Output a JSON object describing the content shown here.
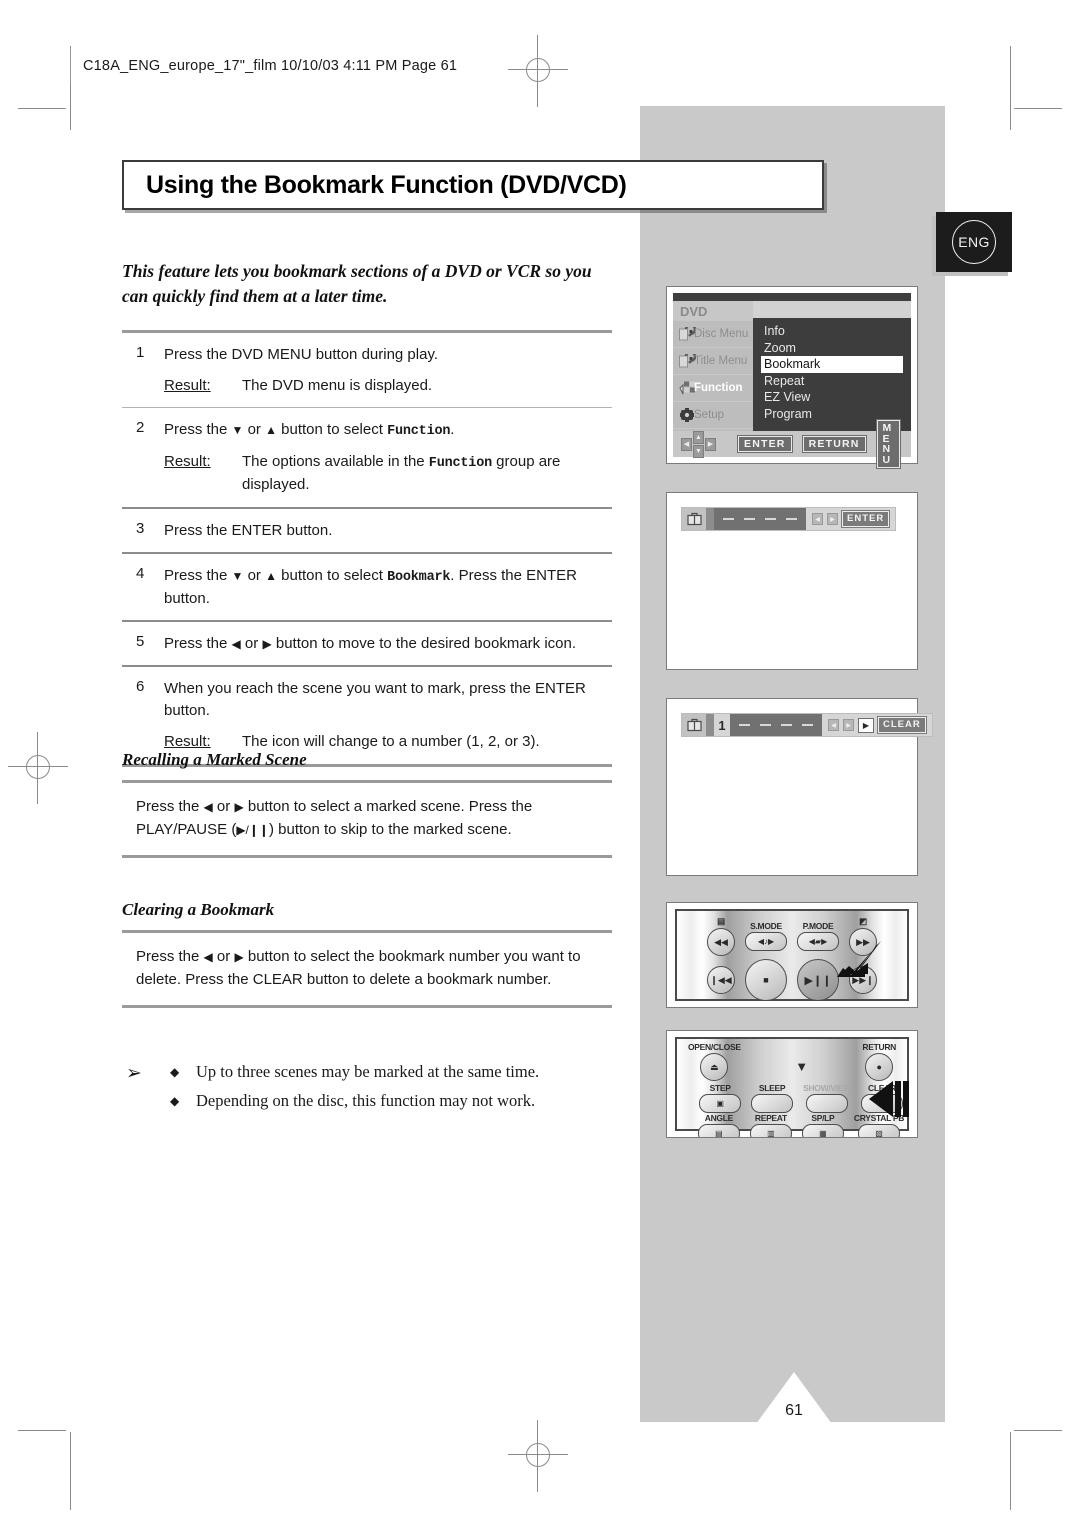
{
  "header": {
    "text": "C18A_ENG_europe_17\"_film  10/10/03  4:11 PM  Page 61"
  },
  "badge": {
    "label": "ENG"
  },
  "title": "Using the Bookmark Function (DVD/VCD)",
  "intro": "This feature lets you bookmark sections of a DVD or VCR so you can quickly find them at a later time.",
  "steps": [
    {
      "num": "1",
      "text_before": "Press the DVD MENU button during play.",
      "result_label": "Result:",
      "result_text": "The DVD menu is displayed."
    },
    {
      "num": "2",
      "text_a": "Press the ",
      "tri_down": "▼",
      "text_b": " or ",
      "tri_up": "▲",
      "text_c": " button to select ",
      "mono": "Function",
      "text_d": ".",
      "result_label": "Result:",
      "result_a": "The options available in the ",
      "result_mono": "Function",
      "result_b": " group are displayed."
    },
    {
      "num": "3",
      "text_before": "Press the ENTER button."
    },
    {
      "num": "4",
      "text_a": "Press the ",
      "tri_down": "▼",
      "text_b": " or ",
      "tri_up": "▲",
      "text_c": " button to select ",
      "mono": "Bookmark",
      "text_d": ". Press the ENTER button."
    },
    {
      "num": "5",
      "text_a": "Press the ",
      "tri_left": "◀",
      "text_b": " or ",
      "tri_right": "▶",
      "text_c": " button to move to the desired bookmark icon."
    },
    {
      "num": "6",
      "text_before": "When you reach the scene you want to mark, press the ENTER button.",
      "result_label": "Result:",
      "result_text": "The icon will change to a number (1, 2, or 3)."
    }
  ],
  "section_recall": {
    "heading": "Recalling a Marked Scene",
    "line_a": "Press the ",
    "tri_left": "◀",
    "line_b": " or ",
    "tri_right": "▶",
    "line_c": " button to select a marked scene. Press the PLAY/PAUSE (",
    "play_pause_glyph": "▶/❙❙",
    "line_d": ") button to skip to the marked scene."
  },
  "section_clear": {
    "heading": "Clearing a Bookmark",
    "line_a": "Press the ",
    "tri_left": "◀",
    "line_b": " or ",
    "tri_right": "▶",
    "line_c": " button to select the bookmark number you want to delete. Press the CLEAR button to delete a bookmark number."
  },
  "notes": {
    "arrow_glyph": "➢",
    "bullet_glyph": "◆",
    "items": [
      "Up to three scenes may be marked at the same time.",
      "Depending on the disc, this function may not work."
    ]
  },
  "osd_menu": {
    "header": "DVD",
    "sidebar": [
      {
        "label": "Disc Menu",
        "icon": "disc-menu-icon",
        "active": false
      },
      {
        "label": "Title Menu",
        "icon": "title-menu-icon",
        "active": false
      },
      {
        "label": "Function",
        "icon": "function-icon",
        "active": true
      },
      {
        "label": "Setup",
        "icon": "setup-gear-icon",
        "active": false
      }
    ],
    "items": [
      {
        "label": "Info",
        "selected": false
      },
      {
        "label": "Zoom",
        "selected": false
      },
      {
        "label": "Bookmark",
        "selected": true
      },
      {
        "label": "Repeat",
        "selected": false
      },
      {
        "label": "EZ View",
        "selected": false
      },
      {
        "label": "Program",
        "selected": false
      }
    ],
    "buttons": [
      "ENTER",
      "RETURN",
      "M E N U"
    ],
    "dpad": {
      "left": "◀",
      "right": "▶",
      "up": "▲",
      "down": "▼"
    }
  },
  "bookmark_bar_1": {
    "icon": "bookmark-icon",
    "slots": [
      "–",
      "–",
      "–",
      "–"
    ],
    "nav_left": "◀",
    "nav_right": "▶",
    "button": "ENTER"
  },
  "bookmark_bar_2": {
    "icon": "bookmark-icon",
    "number": "1",
    "slots": [
      "–",
      "–",
      "–",
      "–"
    ],
    "nav_left": "◀",
    "nav_right": "▶",
    "play_glyph": "▶",
    "button": "CLEAR"
  },
  "remote_top": {
    "row1": [
      {
        "cap": "",
        "icon": "subtitle-icon",
        "glyph": "◀◀",
        "type": "round"
      },
      {
        "cap": "S.MODE",
        "glyph": "◀♪▶",
        "type": "oval"
      },
      {
        "cap": "P.MODE",
        "glyph": "◀▰▶",
        "type": "oval"
      },
      {
        "cap": "",
        "icon": "screen-icon",
        "glyph": "▶▶",
        "type": "round"
      }
    ],
    "row2": [
      {
        "glyph": "❙◀◀",
        "type": "round"
      },
      {
        "glyph": "■",
        "type": "big"
      },
      {
        "glyph": "▶❙❙",
        "type": "big-dark"
      },
      {
        "glyph": "▶▶❙",
        "type": "round"
      }
    ],
    "top_icons": [
      "▤",
      "S.MODE",
      "P.MODE",
      "◩"
    ],
    "pointer": "cursor-arrow"
  },
  "remote_bottom": {
    "row1": [
      {
        "cap": "OPEN/CLOSE",
        "glyph": "⏏",
        "type": "round"
      },
      {
        "cap": "",
        "glyph": "▼",
        "type": "dpad"
      },
      {
        "cap": "RETURN",
        "glyph": "●",
        "type": "round"
      }
    ],
    "row2": [
      {
        "cap": "STEP",
        "glyph": "▣",
        "type": "oval"
      },
      {
        "cap": "SLEEP",
        "glyph": "",
        "type": "oval"
      },
      {
        "cap": "SHOW/VIEW",
        "glyph": "",
        "type": "oval",
        "dim": true
      },
      {
        "cap": "CLEAR",
        "glyph": "X",
        "type": "oval"
      }
    ],
    "row3": [
      {
        "cap": "ANGLE",
        "glyph": "▤",
        "type": "oval"
      },
      {
        "cap": "REPEAT",
        "glyph": "▥",
        "type": "oval"
      },
      {
        "cap": "SP/LP",
        "glyph": "▦",
        "type": "oval"
      },
      {
        "cap": "CRYSTAL PB",
        "glyph": "▧",
        "type": "oval"
      }
    ],
    "pointer": "cursor-arrow"
  },
  "page_number": "61",
  "colors": {
    "band_gray": "#c9c9c9",
    "rule_gray": "#9a9a9a",
    "osd_dark": "#3d3d3d",
    "badge_dark": "#1c1c1c"
  }
}
